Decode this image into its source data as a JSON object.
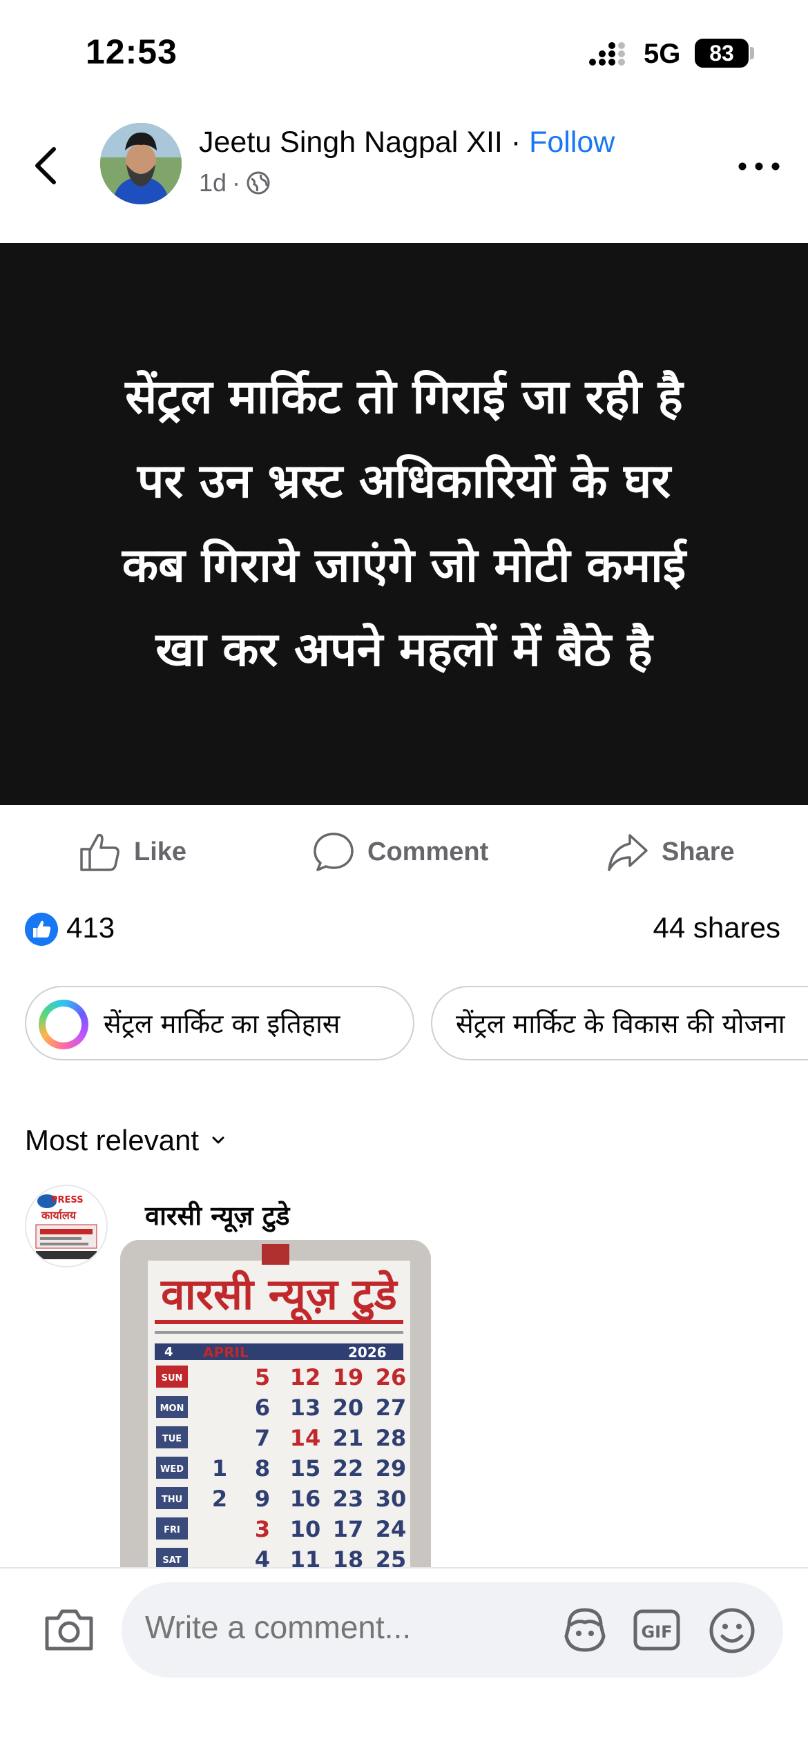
{
  "status_bar": {
    "time": "12:53",
    "network": "5G",
    "battery": "83"
  },
  "post": {
    "author": "Jeetu Singh Nagpal XII",
    "separator": "·",
    "follow_label": "Follow",
    "age": "1d",
    "meta_dot": "·",
    "image_lines": [
      "सेंट्रल मार्किट तो गिराई जा रही है",
      "पर उन भ्रस्ट अधिकारियों के घर",
      "कब गिराये जाएंगे जो मोटी कमाई",
      "खा कर अपने महलों में बैठे है"
    ]
  },
  "actions": {
    "like": "Like",
    "comment": "Comment",
    "share": "Share"
  },
  "reactions": {
    "like_count": "413",
    "shares": "44 shares"
  },
  "topic_chips": [
    "सेंट्रल मार्किट का इतिहास",
    "सेंट्रल मार्किट के विकास की योजना"
  ],
  "comments_sort": {
    "label": "Most relevant"
  },
  "comment": {
    "author": "वारसी न्यूज़ टुडे",
    "photo": {
      "title": "वारसी न्यूज़ टुडे",
      "month": "APRIL",
      "year": "2026",
      "month_num": "4",
      "days": [
        "SUN",
        "MON",
        "TUE",
        "WED",
        "THU",
        "FRI",
        "SAT"
      ],
      "rows": [
        [
          "5",
          "12",
          "19",
          "26"
        ],
        [
          "6",
          "13",
          "20",
          "27"
        ],
        [
          "7",
          "14",
          "21",
          "28"
        ],
        [
          "1",
          "8",
          "15",
          "22",
          "29"
        ],
        [
          "2",
          "9",
          "16",
          "23",
          "30"
        ],
        [
          "3",
          "10",
          "17",
          "24"
        ],
        [
          "4",
          "11",
          "18",
          "25"
        ]
      ]
    },
    "avatar_badge": "PRESS",
    "avatar_text": "कार्यालय"
  },
  "composer": {
    "placeholder": "Write a comment...",
    "gif_label": "GIF"
  },
  "colors": {
    "brand_blue": "#1877f2",
    "muted": "#65676b",
    "image_bg": "#121212"
  },
  "icons": [
    "back-icon",
    "globe-icon",
    "more-icon",
    "like-icon",
    "comment-icon",
    "share-icon",
    "camera-icon",
    "avatar-sticker-icon",
    "gif-icon",
    "emoji-icon"
  ]
}
